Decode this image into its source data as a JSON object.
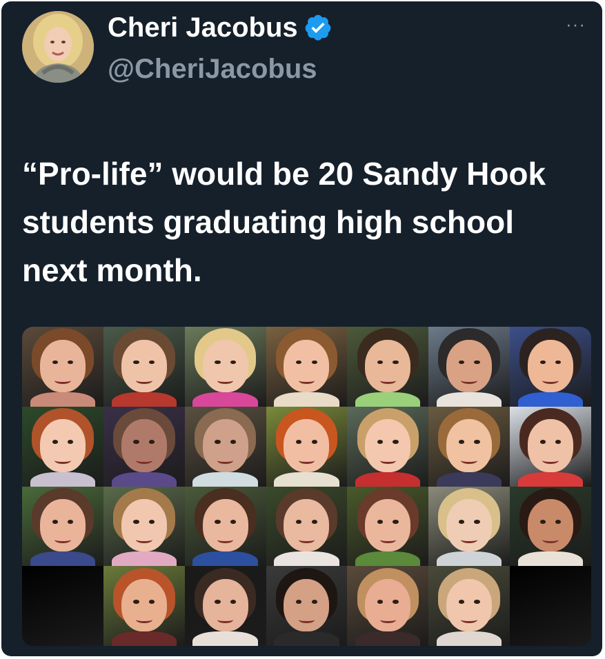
{
  "tweet": {
    "display_name": "Cheri Jacobus",
    "handle": "@CheriJacobus",
    "more_label": "···",
    "text": "“Pro-life” would be 20 Sandy Hook students graduating high school next month."
  },
  "icons": {
    "verified": "verified-badge-icon",
    "more": "more-options-icon"
  },
  "colors": {
    "background": "#15202b",
    "text_primary": "#ffffff",
    "text_secondary": "#8b98a5",
    "verified_badge": "#1d9bf0"
  },
  "media": {
    "faces": [
      {
        "bg": "#5b4a3a",
        "hair": "#7a4a2a",
        "skin": "#e8b49a",
        "shirt": "#c98a7a"
      },
      {
        "bg": "#4a5a4a",
        "hair": "#6b4a33",
        "skin": "#efc3a8",
        "shirt": "#b7382c"
      },
      {
        "bg": "#6b7a5a",
        "hair": "#e2c98a",
        "skin": "#f0c7ac",
        "shirt": "#d9479a"
      },
      {
        "bg": "#7a6040",
        "hair": "#8b5a30",
        "skin": "#f1c0a4",
        "shirt": "#e8dbc8"
      },
      {
        "bg": "#4d5a3a",
        "hair": "#3b2a1e",
        "skin": "#e8b899",
        "shirt": "#9bd07a"
      },
      {
        "bg": "#6c7a8a",
        "hair": "#2c2a2a",
        "skin": "#d9a284",
        "shirt": "#e9e3de"
      },
      {
        "bg": "#3c4f8a",
        "hair": "#2c2320",
        "skin": "#eeb896",
        "shirt": "#2f5fd0"
      },
      {
        "bg": "#2c4a2a",
        "hair": "#b0532a",
        "skin": "#f4c9b1",
        "shirt": "#c9c0cf"
      },
      {
        "bg": "#3a3048",
        "hair": "#6a4a3a",
        "skin": "#b07a6a",
        "shirt": "#5a4a8a"
      },
      {
        "bg": "#5a5040",
        "hair": "#8a6a50",
        "skin": "#cfa08a",
        "shirt": "#d0dce0"
      },
      {
        "bg": "#7a8a3a",
        "hair": "#c9561f",
        "skin": "#f1bea4",
        "shirt": "#e6e0d0"
      },
      {
        "bg": "#5a6a5a",
        "hair": "#c9a06a",
        "skin": "#f3c8ae",
        "shirt": "#c62f2f"
      },
      {
        "bg": "#6a5a40",
        "hair": "#9a6a3a",
        "skin": "#f0c2a2",
        "shirt": "#3c3a5a"
      },
      {
        "bg": "#dbe0e8",
        "hair": "#4a2a20",
        "skin": "#efc1a6",
        "shirt": "#d93a3a"
      },
      {
        "bg": "#4a6a3a",
        "hair": "#5a3a2a",
        "skin": "#e9b49a",
        "shirt": "#3a4a8a"
      },
      {
        "bg": "#5a6a4a",
        "hair": "#a57a4a",
        "skin": "#f2c7b0",
        "shirt": "#e2aac2"
      },
      {
        "bg": "#4a5a3a",
        "hair": "#4a2e20",
        "skin": "#eab89e",
        "shirt": "#2d4fa0"
      },
      {
        "bg": "#3a4a2a",
        "hair": "#5a3a2a",
        "skin": "#e9b9a0",
        "shirt": "#e9e4e0"
      },
      {
        "bg": "#4a5a2a",
        "hair": "#6a3a2a",
        "skin": "#eab79c",
        "shirt": "#5a8a3a"
      },
      {
        "bg": "#8a8a7a",
        "hair": "#d9c08a",
        "skin": "#efcdb5",
        "shirt": "#cdd3d6"
      },
      {
        "bg": "#2a3a2a",
        "hair": "#2a1a14",
        "skin": "#c98a6a",
        "shirt": "#e9e1d6"
      },
      {
        "bg": "#000000",
        "hair": "#000000",
        "skin": "#000000",
        "shirt": "#000000",
        "blank": true
      },
      {
        "bg": "#6a7a3a",
        "hair": "#b9532a",
        "skin": "#e8b08f",
        "shirt": "#6a2a2a"
      },
      {
        "bg": "#1a1a1a",
        "hair": "#3a2a22",
        "skin": "#e6b49a",
        "shirt": "#e8e0d8"
      },
      {
        "bg": "#3a3a3a",
        "hair": "#1e1612",
        "skin": "#d4a086",
        "shirt": "#2a2a2a"
      },
      {
        "bg": "#5a4a3a",
        "hair": "#c09060",
        "skin": "#e8ad92",
        "shirt": "#3a2a2a"
      },
      {
        "bg": "#4a4a3a",
        "hair": "#c9a77a",
        "skin": "#f0c6ac",
        "shirt": "#e0d8d0"
      },
      {
        "bg": "#000000",
        "hair": "#000000",
        "skin": "#000000",
        "shirt": "#000000",
        "blank": true
      }
    ]
  }
}
